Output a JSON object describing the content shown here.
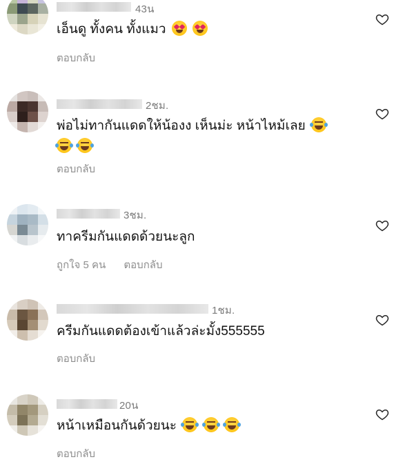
{
  "comments": [
    {
      "time": "43น",
      "text": "เอ็นดู ทั้งคน ทั้งแมว",
      "emojis": [
        "heart-eyes",
        "heart-eyes"
      ],
      "reply_label": "ตอบกลับ"
    },
    {
      "time": "2ชม.",
      "text_line1": "พ่อไม่ทากันแดดให้น้องง เห็นม่ะ หน้าไหม้เลย",
      "emojis_line1": [
        "joy"
      ],
      "emojis_line2": [
        "joy",
        "joy"
      ],
      "reply_label": "ตอบกลับ"
    },
    {
      "time": "3ชม.",
      "text": "ทาครีมกันแดดด้วยนะลูก",
      "likes_label": "ถูกใจ 5 คน",
      "reply_label": "ตอบกลับ"
    },
    {
      "time": "1ชม.",
      "text": "ครีมกันแดดต้องเข้าแล้วล่ะมั้ง555555",
      "reply_label": "ตอบกลับ"
    },
    {
      "time": "20น",
      "text": "หน้าเหมือนกันด้วยนะ",
      "emojis": [
        "joy",
        "joy",
        "joy"
      ],
      "reply_label": "ตอบกลับ"
    }
  ],
  "icons": {
    "like": "heart-outline-icon"
  }
}
